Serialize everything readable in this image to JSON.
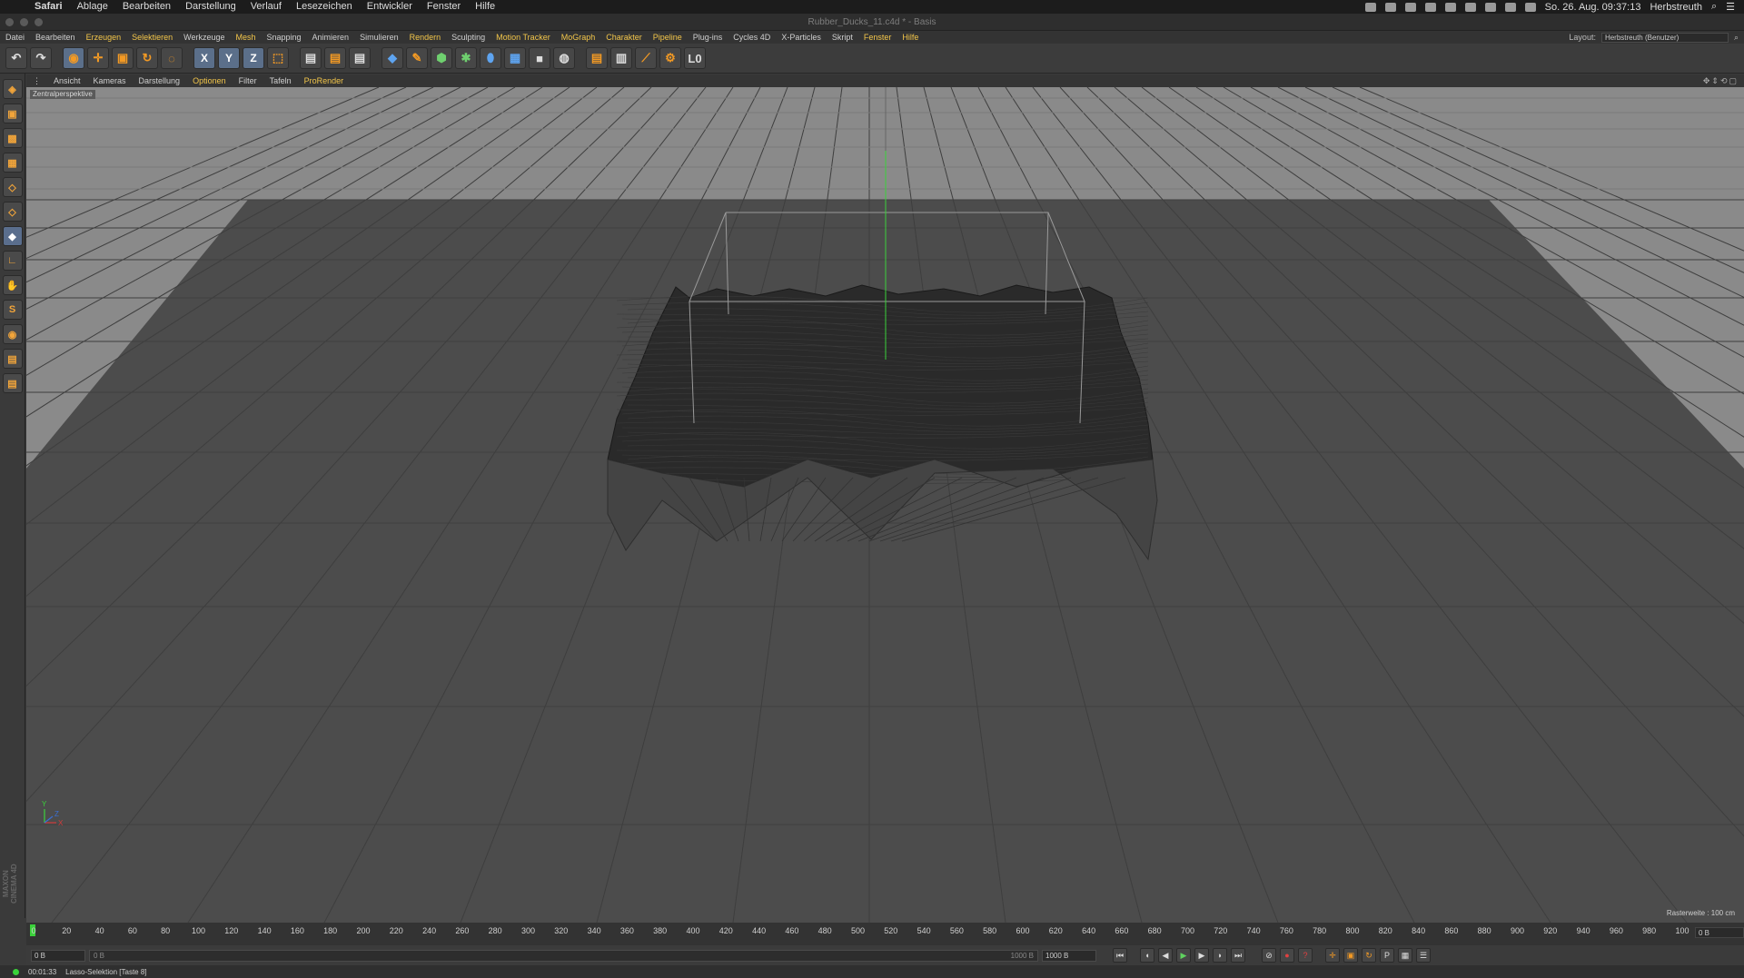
{
  "mac_menubar": {
    "apple": "",
    "app": "Safari",
    "items": [
      "Ablage",
      "Bearbeiten",
      "Darstellung",
      "Verlauf",
      "Lesezeichen",
      "Entwickler",
      "Fenster",
      "Hilfe"
    ],
    "datetime": "So. 26. Aug.  09:37:13",
    "user": "Herbstreuth"
  },
  "window": {
    "title": "Rubber_Ducks_11.c4d * - Basis"
  },
  "c4d_menu": {
    "items": [
      {
        "label": "Datei",
        "hl": false
      },
      {
        "label": "Bearbeiten",
        "hl": false
      },
      {
        "label": "Erzeugen",
        "hl": true
      },
      {
        "label": "Selektieren",
        "hl": true
      },
      {
        "label": "Werkzeuge",
        "hl": false
      },
      {
        "label": "Mesh",
        "hl": true
      },
      {
        "label": "Snapping",
        "hl": false
      },
      {
        "label": "Animieren",
        "hl": false
      },
      {
        "label": "Simulieren",
        "hl": false
      },
      {
        "label": "Rendern",
        "hl": true
      },
      {
        "label": "Sculpting",
        "hl": false
      },
      {
        "label": "Motion Tracker",
        "hl": true
      },
      {
        "label": "MoGraph",
        "hl": true
      },
      {
        "label": "Charakter",
        "hl": true
      },
      {
        "label": "Pipeline",
        "hl": true
      },
      {
        "label": "Plug-ins",
        "hl": false
      },
      {
        "label": "Cycles 4D",
        "hl": false
      },
      {
        "label": "X-Particles",
        "hl": false
      },
      {
        "label": "Skript",
        "hl": false
      },
      {
        "label": "Fenster",
        "hl": true
      },
      {
        "label": "Hilfe",
        "hl": true
      }
    ],
    "layout_label": "Layout:",
    "layout_value": "Herbstreuth (Benutzer)"
  },
  "toolbar": {
    "axis_x": "X",
    "axis_y": "Y",
    "axis_z": "Z",
    "layer_label": "L0"
  },
  "viewport_menu": {
    "items": [
      {
        "label": "Ansicht",
        "hl": false
      },
      {
        "label": "Kameras",
        "hl": false
      },
      {
        "label": "Darstellung",
        "hl": false
      },
      {
        "label": "Optionen",
        "hl": true
      },
      {
        "label": "Filter",
        "hl": false
      },
      {
        "label": "Tafeln",
        "hl": false
      },
      {
        "label": "ProRender",
        "hl": true
      }
    ]
  },
  "viewport": {
    "label": "Zentralperspektive",
    "grid_info": "Rasterweite : 100 cm",
    "axis_x": "X",
    "axis_y": "Y",
    "axis_z": "Z"
  },
  "timeline": {
    "ticks": [
      "0",
      "20",
      "40",
      "60",
      "80",
      "100",
      "120",
      "140",
      "160",
      "180",
      "200",
      "220",
      "240",
      "260",
      "280",
      "300",
      "320",
      "340",
      "360",
      "380",
      "400",
      "420",
      "440",
      "460",
      "480",
      "500",
      "520",
      "540",
      "560",
      "580",
      "600",
      "620",
      "640",
      "660",
      "680",
      "700",
      "720",
      "740",
      "760",
      "780",
      "800",
      "820",
      "840",
      "860",
      "880",
      "900",
      "920",
      "940",
      "960",
      "980",
      "100"
    ],
    "current_frame": "0 B"
  },
  "transport": {
    "start_field": "0 B",
    "slider_left": "0 B",
    "slider_right": "1000 B",
    "end_field": "1000 B"
  },
  "statusbar": {
    "time": "00:01:33",
    "message": "Lasso-Selektion [Taste 8]"
  },
  "colors": {
    "accent_yellow": "#f3c64a",
    "tool_orange": "#f39a24",
    "active_blue": "#5a6e8d",
    "playhead_green": "#3ad13a"
  }
}
